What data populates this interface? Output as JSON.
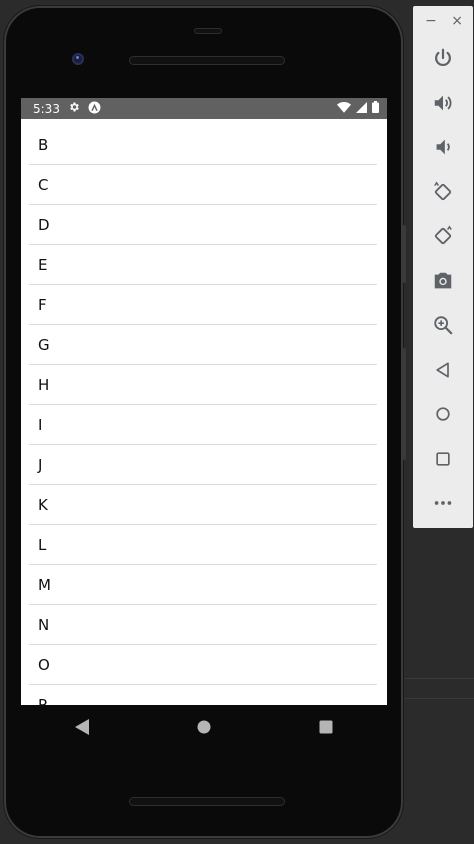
{
  "status_bar": {
    "time": "5:33"
  },
  "list": {
    "items": [
      "B",
      "C",
      "D",
      "E",
      "F",
      "G",
      "H",
      "I",
      "J",
      "K",
      "L",
      "M",
      "N",
      "O",
      "P"
    ]
  },
  "nav": {
    "back_icon": "back-triangle",
    "home_icon": "home-circle",
    "recents_icon": "recents-square"
  },
  "emulator_panel": {
    "minimize_label": "−",
    "close_label": "×",
    "tools": [
      "power",
      "volume-up",
      "volume-down",
      "rotate-left",
      "rotate-right",
      "screenshot",
      "zoom",
      "back",
      "home",
      "overview",
      "more"
    ]
  },
  "colors": {
    "statusbar": "#616161",
    "panel": "#ececec",
    "panel_icon": "#5f6368",
    "divider": "#dcdcdc"
  }
}
